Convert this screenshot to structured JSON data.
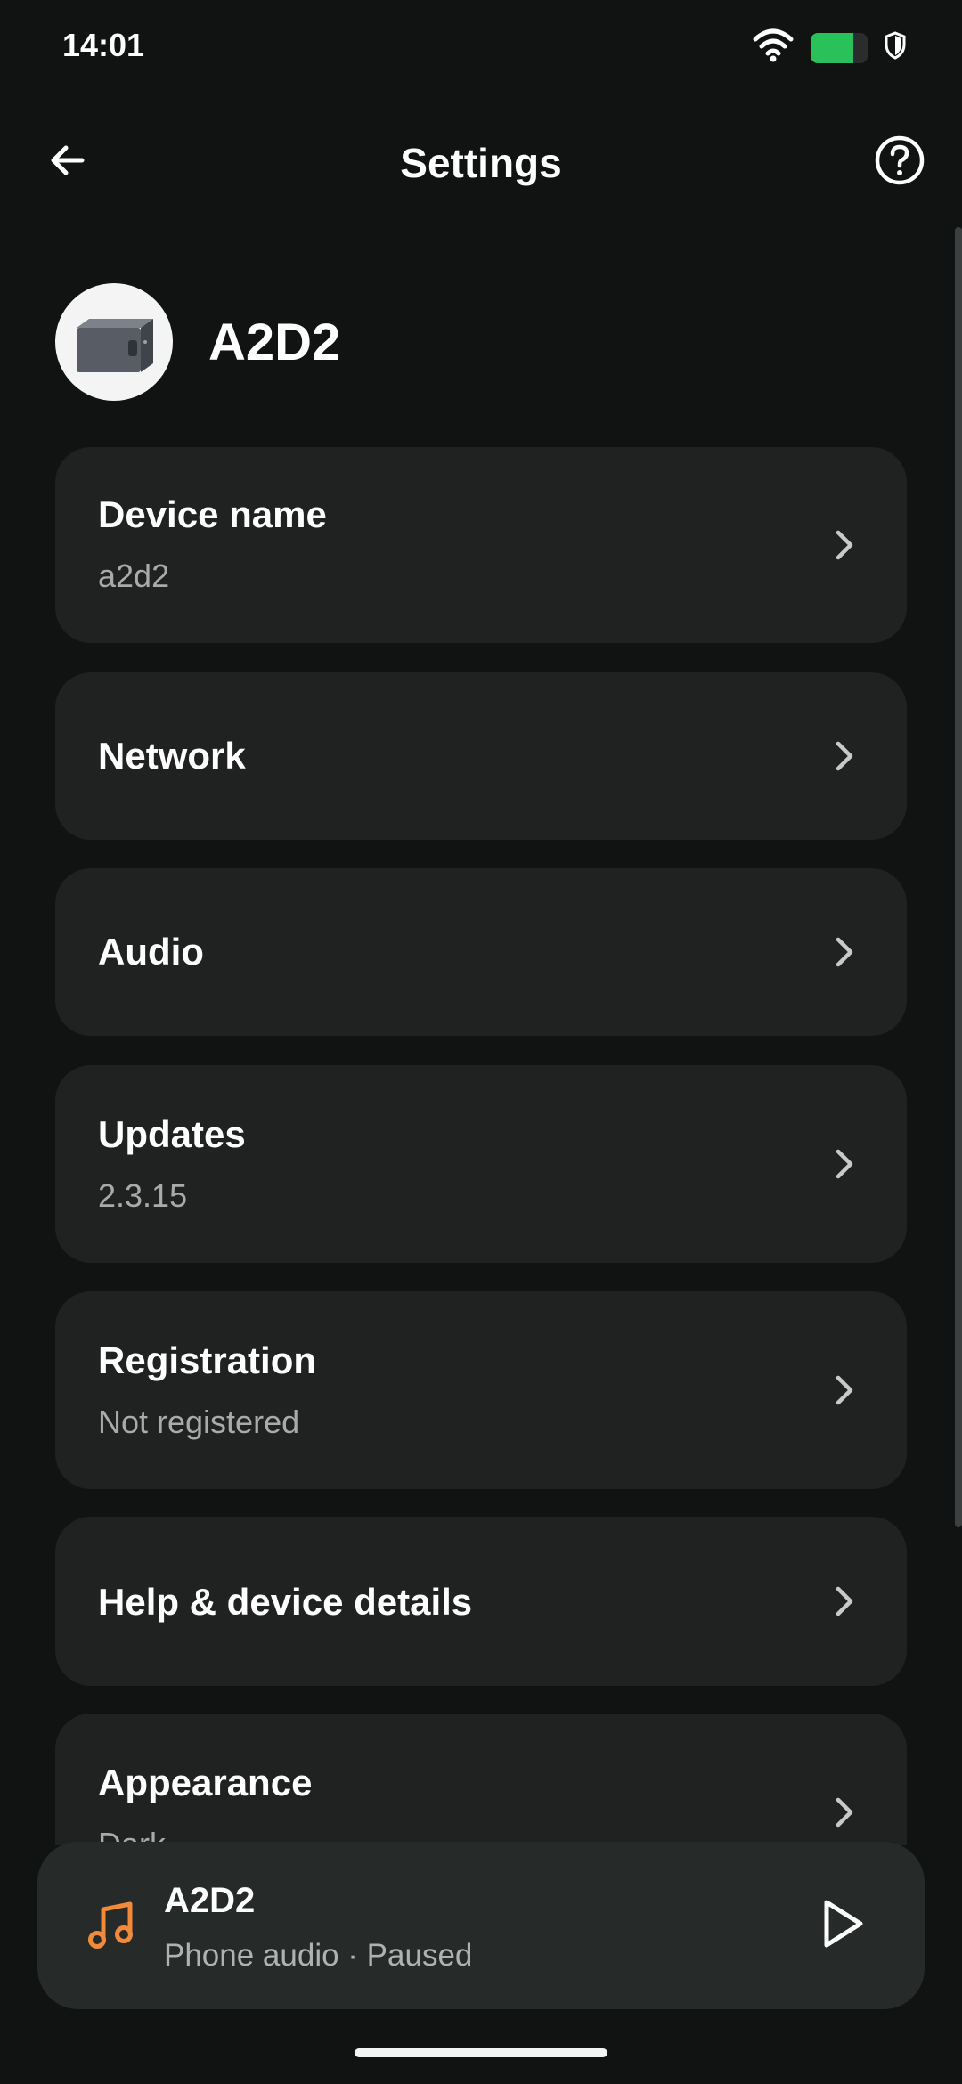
{
  "status_bar": {
    "time": "14:01",
    "icons": [
      "wifi-icon",
      "battery-icon",
      "shield-icon"
    ],
    "battery_level": 0.75,
    "battery_color": "#29c25a"
  },
  "header": {
    "title": "Settings",
    "back_icon": "arrow-left-icon",
    "help_icon": "help-circle-icon"
  },
  "device": {
    "name": "A2D2",
    "avatar_icon": "device-box-icon"
  },
  "settings": [
    {
      "label": "Device name",
      "value": "a2d2"
    },
    {
      "label": "Network",
      "value": ""
    },
    {
      "label": "Audio",
      "value": ""
    },
    {
      "label": "Updates",
      "value": "2.3.15"
    },
    {
      "label": "Registration",
      "value": "Not registered"
    },
    {
      "label": "Help & device details",
      "value": ""
    },
    {
      "label": "Appearance",
      "value": "Dark"
    }
  ],
  "player": {
    "title": "A2D2",
    "subtitle": "Phone audio · Paused",
    "icon": "music-note-icon",
    "action_icon": "play-icon",
    "accent": "#f08a3c"
  },
  "colors": {
    "background": "#111313",
    "card": "#1f2221",
    "player": "#262a29"
  }
}
